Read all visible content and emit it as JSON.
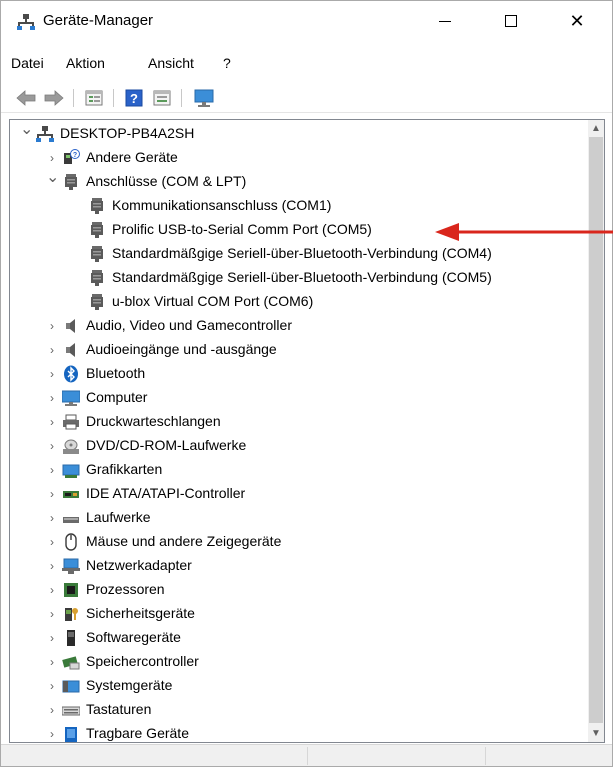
{
  "window": {
    "title": "Geräte-Manager",
    "icon": "device-manager-icon",
    "controls": {
      "minimize": "minimize-icon",
      "maximize": "maximize-icon",
      "close": "close-icon"
    }
  },
  "menubar": {
    "items": [
      "Datei",
      "Aktion",
      "Ansicht",
      "?"
    ]
  },
  "toolbar": {
    "buttons": [
      "back-arrow-icon",
      "forward-arrow-icon",
      "properties-icon",
      "help-icon",
      "view-icon",
      "monitor-icon"
    ]
  },
  "tree": {
    "root": {
      "label": "DESKTOP-PB4A2SH",
      "icon": "computer-tree-icon",
      "expanded": true
    },
    "items": [
      {
        "label": "Andere Geräte",
        "icon": "unknown-device-icon",
        "expanded": false,
        "level": 1
      },
      {
        "label": "Anschlüsse (COM & LPT)",
        "icon": "port-icon",
        "expanded": true,
        "level": 1
      },
      {
        "label": "Kommunikationsanschluss (COM1)",
        "icon": "port-icon",
        "level": 2
      },
      {
        "label": "Prolific USB-to-Serial Comm Port (COM5)",
        "icon": "port-icon",
        "level": 2
      },
      {
        "label": "Standardmäßgige Seriell-über-Bluetooth-Verbindung (COM4)",
        "icon": "port-icon",
        "level": 2
      },
      {
        "label": "Standardmäßgige Seriell-über-Bluetooth-Verbindung (COM5)",
        "icon": "port-icon",
        "level": 2
      },
      {
        "label": "u-blox Virtual COM Port (COM6)",
        "icon": "port-icon",
        "level": 2
      },
      {
        "label": "Audio, Video und Gamecontroller",
        "icon": "speaker-icon",
        "expanded": false,
        "level": 1
      },
      {
        "label": "Audioeingänge und -ausgänge",
        "icon": "speaker-icon",
        "expanded": false,
        "level": 1
      },
      {
        "label": "Bluetooth",
        "icon": "bluetooth-icon",
        "expanded": false,
        "level": 1
      },
      {
        "label": "Computer",
        "icon": "monitor-icon",
        "expanded": false,
        "level": 1
      },
      {
        "label": "Druckwarteschlangen",
        "icon": "printer-icon",
        "expanded": false,
        "level": 1
      },
      {
        "label": "DVD/CD-ROM-Laufwerke",
        "icon": "disc-drive-icon",
        "expanded": false,
        "level": 1
      },
      {
        "label": "Grafikkarten",
        "icon": "display-adapter-icon",
        "expanded": false,
        "level": 1
      },
      {
        "label": "IDE ATA/ATAPI-Controller",
        "icon": "ide-controller-icon",
        "expanded": false,
        "level": 1
      },
      {
        "label": "Laufwerke",
        "icon": "disk-drive-icon",
        "expanded": false,
        "level": 1
      },
      {
        "label": "Mäuse und andere Zeigegeräte",
        "icon": "mouse-icon",
        "expanded": false,
        "level": 1
      },
      {
        "label": "Netzwerkadapter",
        "icon": "network-adapter-icon",
        "expanded": false,
        "level": 1
      },
      {
        "label": "Prozessoren",
        "icon": "processor-icon",
        "expanded": false,
        "level": 1
      },
      {
        "label": "Sicherheitsgeräte",
        "icon": "security-device-icon",
        "expanded": false,
        "level": 1
      },
      {
        "label": "Softwaregeräte",
        "icon": "software-device-icon",
        "expanded": false,
        "level": 1
      },
      {
        "label": "Speichercontroller",
        "icon": "storage-controller-icon",
        "expanded": false,
        "level": 1
      },
      {
        "label": "Systemgeräte",
        "icon": "system-device-icon",
        "expanded": false,
        "level": 1
      },
      {
        "label": "Tastaturen",
        "icon": "keyboard-icon",
        "expanded": false,
        "level": 1
      },
      {
        "label": "Tragbare Geräte",
        "icon": "portable-device-icon",
        "expanded": false,
        "level": 1
      }
    ]
  },
  "annotation": {
    "color": "#d9261c",
    "points_to": "Prolific USB-to-Serial Comm Port (COM5)"
  },
  "colors": {
    "bluetooth": "#1565c0",
    "arrow": "#d9261c",
    "selection_border": "#828790"
  }
}
